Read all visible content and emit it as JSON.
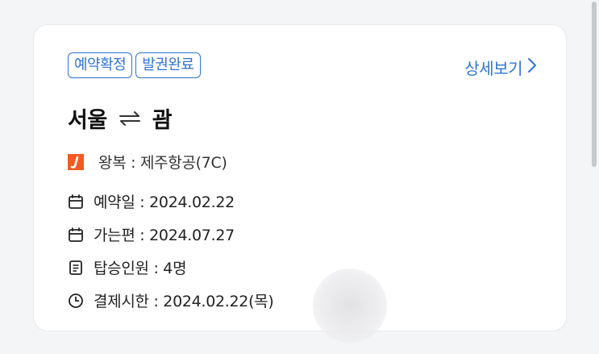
{
  "reservation": {
    "badges": [
      "예약확정",
      "발권완료"
    ],
    "detail_label": "상세보기",
    "route": {
      "from": "서울",
      "to": "괌"
    },
    "airline_text": "왕복 : 제주항공(7C)",
    "rows": {
      "booking_date": "예약일 : 2024.02.22",
      "departure": "가는편 : 2024.07.27",
      "passengers": "탑승인원 : 4명",
      "payment_deadline": "결제시한 : 2024.02.22(목)"
    }
  },
  "colors": {
    "accent": "#2f74d0",
    "airline_logo": "#f15a22"
  },
  "icons": {
    "detail": "chevron-right-icon",
    "route": "round-trip-arrows-icon",
    "airline": "jeju-air-logo",
    "booking_date": "calendar-icon",
    "departure": "calendar-icon",
    "passengers": "document-icon",
    "payment_deadline": "clock-icon"
  }
}
